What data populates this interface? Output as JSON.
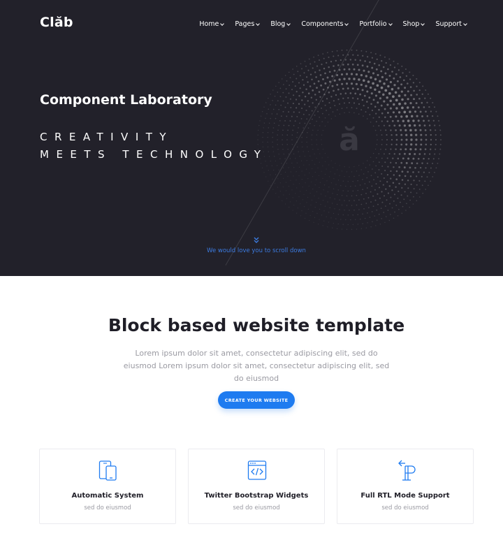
{
  "brand": {
    "logo": "Clăb"
  },
  "nav": {
    "items": [
      {
        "label": "Home"
      },
      {
        "label": "Pages"
      },
      {
        "label": "Blog"
      },
      {
        "label": "Components"
      },
      {
        "label": "Portfolio"
      },
      {
        "label": "Shop"
      },
      {
        "label": "Support"
      }
    ]
  },
  "hero": {
    "title": "Component Laboratory",
    "tagline_line1": "CREATIVITY",
    "tagline_line2": "MEETS TECHNOLOGY",
    "art_letter": "ă",
    "scroll_text": "We would love you to scroll down"
  },
  "section": {
    "title": "Block based website template",
    "description": "Lorem ipsum dolor sit amet, consectetur adipiscing elit, sed do eiusmod Lorem ipsum dolor sit amet, consectetur adipiscing elit, sed do eiusmod",
    "cta_label": "CREATE YOUR WEBSITE"
  },
  "features": [
    {
      "icon": "devices-icon",
      "title": "Automatic System",
      "subtitle": "sed do eiusmod"
    },
    {
      "icon": "code-window-icon",
      "title": "Twitter Bootstrap Widgets",
      "subtitle": "sed do eiusmod"
    },
    {
      "icon": "rtl-paragraph-icon",
      "title": "Full RTL Mode Support",
      "subtitle": "sed do eiusmod"
    }
  ],
  "colors": {
    "hero_bg": "#22212a",
    "accent": "#1e7bf0",
    "heading": "#1f1e27",
    "muted": "#9a9aa2"
  }
}
